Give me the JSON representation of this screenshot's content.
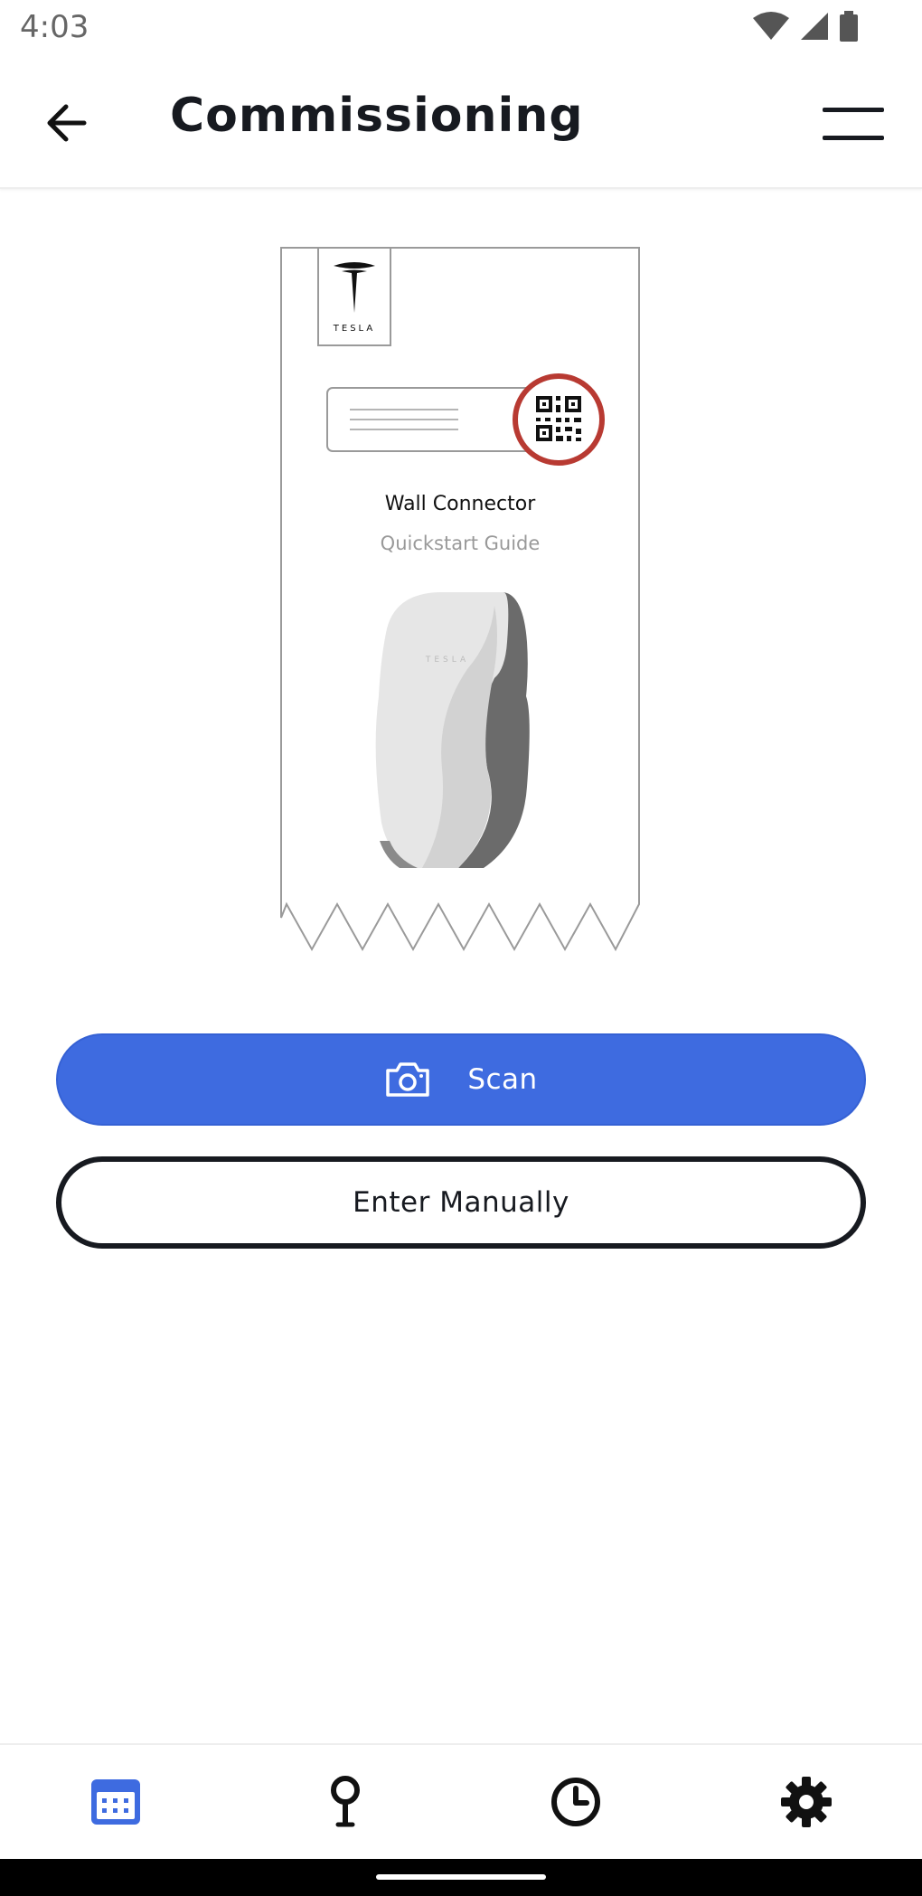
{
  "status_bar": {
    "time": "4:03",
    "icons": [
      "wifi-icon",
      "signal-icon",
      "battery-icon"
    ]
  },
  "header": {
    "title": "Commissioning",
    "back_icon": "arrow-left-icon",
    "menu_icon": "hamburger-menu-icon"
  },
  "illustration": {
    "brand": "TESLA",
    "title": "Wall Connector",
    "subtitle": "Quickstart Guide",
    "device_brand": "TESLA"
  },
  "actions": {
    "scan_label": "Scan",
    "scan_icon": "camera-icon",
    "manual_label": "Enter Manually"
  },
  "bottom_nav": {
    "items": [
      {
        "icon": "calendar-icon",
        "active": true
      },
      {
        "icon": "location-pin-icon",
        "active": false
      },
      {
        "icon": "clock-icon",
        "active": false
      },
      {
        "icon": "gear-icon",
        "active": false
      }
    ]
  },
  "colors": {
    "primary": "#3e6be0",
    "text": "#171a20",
    "qr_highlight": "#b83a32",
    "muted": "#999999"
  }
}
